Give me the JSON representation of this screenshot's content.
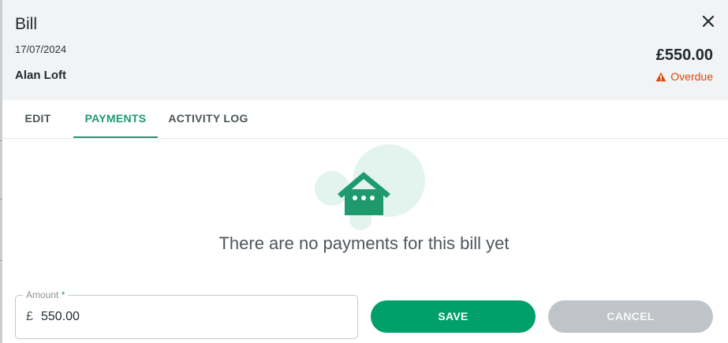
{
  "bill": {
    "title": "Bill",
    "date": "17/07/2024",
    "customer": "Alan Loft",
    "amount": "£550.00",
    "status": "Overdue"
  },
  "tabs": [
    {
      "label": "EDIT",
      "active": false
    },
    {
      "label": "PAYMENTS",
      "active": true
    },
    {
      "label": "ACTIVITY LOG",
      "active": false
    }
  ],
  "payments": {
    "empty_message": "There are no payments for this bill yet"
  },
  "form": {
    "amount_label": "Amount",
    "required_marker": "*",
    "currency_symbol": "£",
    "amount_value": "550.00",
    "save_label": "SAVE",
    "cancel_label": "CANCEL"
  },
  "icons": {
    "close": "close-icon",
    "status": "warning-icon",
    "empty": "house-chat-illustration"
  },
  "colors": {
    "accent": "#1e9a6e",
    "save_button": "#00a06b",
    "cancel_button": "#c0c4c8",
    "overdue": "#d9480f",
    "header_bg": "#f2f3f4"
  }
}
